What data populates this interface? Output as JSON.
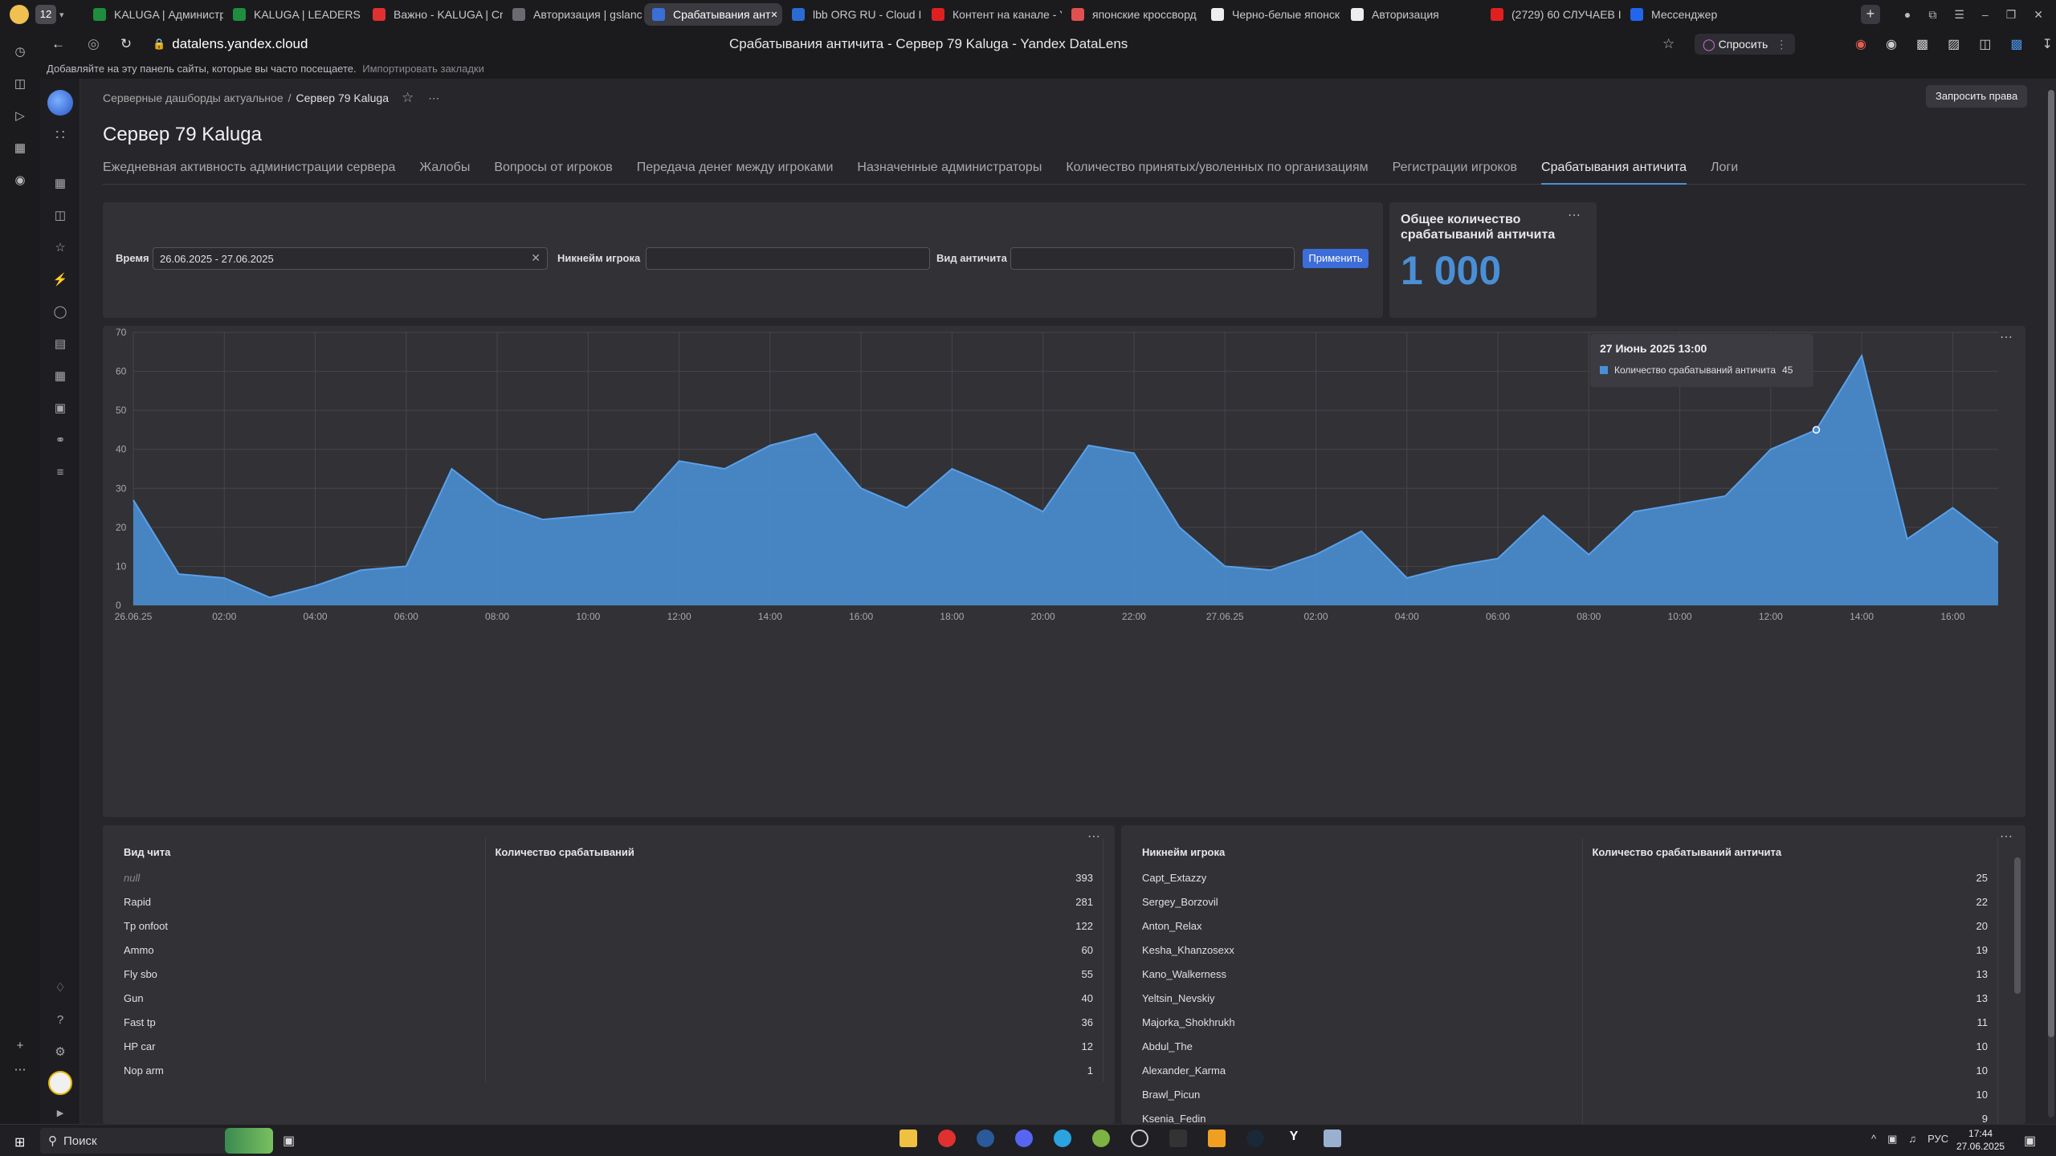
{
  "browser": {
    "tab_count": "12",
    "tabs": [
      {
        "title": "KALUGA | Администр",
        "color": "#1e8e3e"
      },
      {
        "title": "KALUGA | LEADERS",
        "color": "#1e8e3e"
      },
      {
        "title": "Важно - KALUGA | Cr",
        "color": "#e03030"
      },
      {
        "title": "Авторизация | gslanc",
        "color": "#6a6a70"
      },
      {
        "title": "Срабатывания ант",
        "color": "#3a6fd8"
      },
      {
        "title": "lbb ORG RU - Cloud In",
        "color": "#2a6bd6"
      },
      {
        "title": "Контент на канале - Y",
        "color": "#e02020"
      },
      {
        "title": "японские кроссворд",
        "color": "#e05050"
      },
      {
        "title": "Черно-белые японск",
        "color": "#eeeeee"
      },
      {
        "title": "Авторизация",
        "color": "#eeeeee"
      },
      {
        "title": "(2729) 60 СЛУЧАЕВ I",
        "color": "#e02020"
      },
      {
        "title": "Мессенджер",
        "color": "#2266ee"
      }
    ],
    "address": "datalens.yandex.cloud",
    "page_title": "Срабатывания античита - Сервер 79 Kaluga - Yandex DataLens",
    "ask_label": "Спросить",
    "bookmarks_hint": "Добавляйте на эту панель сайты, которые вы часто посещаете.",
    "bookmarks_import": "Импортировать закладки"
  },
  "header": {
    "breadcrumb_parent": "Серверные дашборды актуальное",
    "breadcrumb_sep": "/",
    "breadcrumb_current": "Сервер 79 Kaluga",
    "request_rights": "Запросить права",
    "title": "Сервер 79 Kaluga"
  },
  "tabs": [
    "Ежедневная активность администрации сервера",
    "Жалобы",
    "Вопросы от игроков",
    "Передача денег между игроками",
    "Назначенные администраторы",
    "Количество принятых/уволенных по организациям",
    "Регистрации игроков",
    "Срабатывания античита",
    "Логи"
  ],
  "filters": {
    "time_label": "Время",
    "time_value": "26.06.2025 - 27.06.2025",
    "nick_label": "Никнейм игрока",
    "nick_value": "",
    "type_label": "Вид античита",
    "type_value": "",
    "apply": "Применить"
  },
  "kpi": {
    "title": "Общее количество срабатываний античита",
    "value": "1 000"
  },
  "chart_data": {
    "type": "area",
    "series": [
      {
        "values": [
          27,
          8,
          7,
          2,
          5,
          9,
          10,
          35,
          26,
          22,
          23,
          24,
          37,
          35,
          41,
          44,
          30,
          25,
          35,
          30,
          24,
          41,
          39,
          20,
          10,
          9,
          13,
          19,
          7,
          10,
          12,
          23,
          13,
          24,
          26,
          28,
          40,
          45,
          64,
          17,
          25,
          16
        ]
      }
    ],
    "x_ticks": [
      "26.06.25",
      "02:00",
      "04:00",
      "06:00",
      "08:00",
      "10:00",
      "12:00",
      "14:00",
      "16:00",
      "18:00",
      "20:00",
      "22:00",
      "27.06.25",
      "02:00",
      "04:00",
      "06:00",
      "08:00",
      "10:00",
      "12:00",
      "14:00",
      "16:00"
    ],
    "y_ticks": [
      "0",
      "10",
      "20",
      "30",
      "40",
      "50",
      "60",
      "70"
    ],
    "ylim": [
      0,
      70
    ],
    "grid": true,
    "color": "#4a8fd6",
    "tooltip": {
      "title": "27 Июнь 2025 13:00",
      "label": "Количество срабатываний античита",
      "value": "45"
    }
  },
  "table_cheats": {
    "col1": "Вид чита",
    "col2": "Количество срабатываний",
    "rows": [
      {
        "name": "null",
        "count": "393"
      },
      {
        "name": "Rapid",
        "count": "281"
      },
      {
        "name": "Tp onfoot",
        "count": "122"
      },
      {
        "name": "Ammo",
        "count": "60"
      },
      {
        "name": "Fly sbo",
        "count": "55"
      },
      {
        "name": "Gun",
        "count": "40"
      },
      {
        "name": "Fast tp",
        "count": "36"
      },
      {
        "name": "HP car",
        "count": "12"
      },
      {
        "name": "Nop arm",
        "count": "1"
      }
    ]
  },
  "table_players": {
    "col1": "Никнейм игрока",
    "col2": "Количество срабатываний античита",
    "rows": [
      {
        "name": "Capt_Extazzy",
        "count": "25"
      },
      {
        "name": "Sergey_Borzovil",
        "count": "22"
      },
      {
        "name": "Anton_Relax",
        "count": "20"
      },
      {
        "name": "Kesha_Khanzosexx",
        "count": "19"
      },
      {
        "name": "Kano_Walkerness",
        "count": "13"
      },
      {
        "name": "Yeltsin_Nevskiy",
        "count": "13"
      },
      {
        "name": "Majorka_Shokhrukh",
        "count": "11"
      },
      {
        "name": "Abdul_The",
        "count": "10"
      },
      {
        "name": "Alexander_Karma",
        "count": "10"
      },
      {
        "name": "Brawl_Picun",
        "count": "10"
      },
      {
        "name": "Ksenia_Fedin",
        "count": "9"
      }
    ]
  },
  "taskbar": {
    "search": "Поиск",
    "lang": "РУС",
    "time": "17:44",
    "date": "27.06.2025"
  }
}
